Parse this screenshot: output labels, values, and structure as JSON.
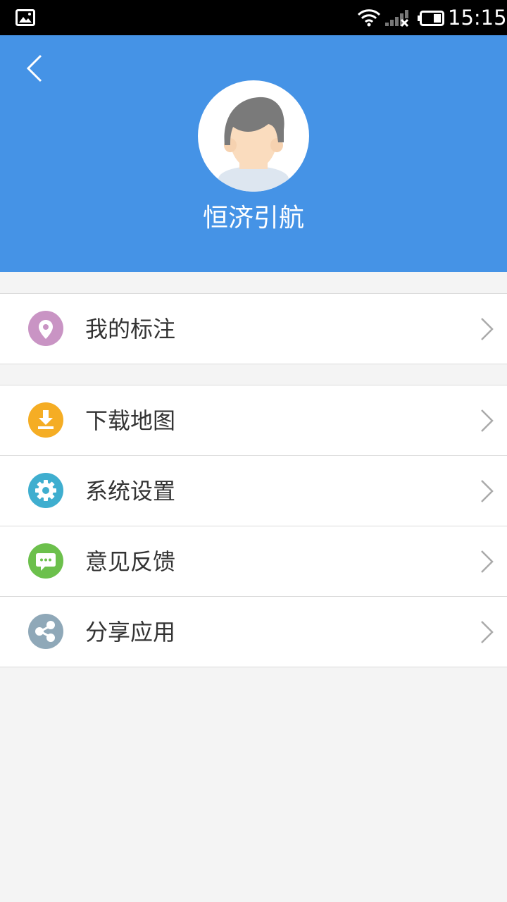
{
  "status_bar": {
    "time": "15:15"
  },
  "header": {
    "username": "恒济引航",
    "background": "#4593e6"
  },
  "menu": {
    "group1": [
      {
        "label": "我的标注",
        "icon": "map-pin-icon",
        "color": "#c994c4"
      }
    ],
    "group2": [
      {
        "label": "下载地图",
        "icon": "download-icon",
        "color": "#f5ad24"
      },
      {
        "label": "系统设置",
        "icon": "gear-icon",
        "color": "#3faecf"
      },
      {
        "label": "意见反馈",
        "icon": "chat-bubble-icon",
        "color": "#6cc04c"
      },
      {
        "label": "分享应用",
        "icon": "share-icon",
        "color": "#8fa8b8"
      }
    ]
  }
}
